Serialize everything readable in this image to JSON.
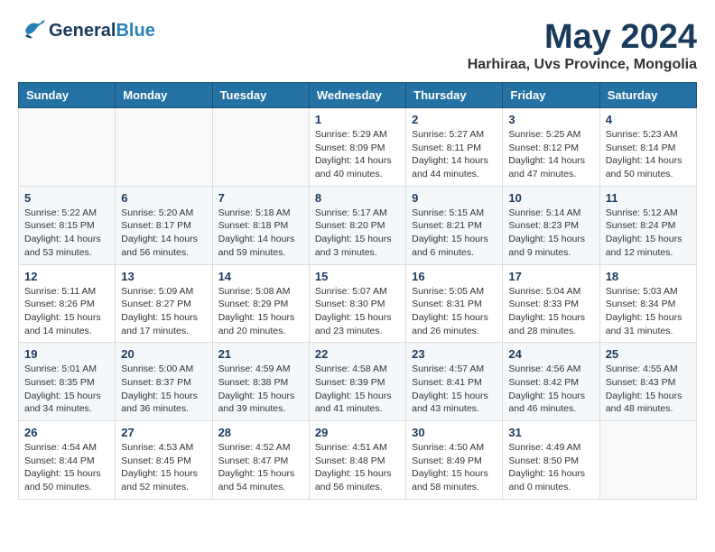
{
  "header": {
    "logo_general": "General",
    "logo_blue": "Blue",
    "month_title": "May 2024",
    "location": "Harhiraa, Uvs Province, Mongolia"
  },
  "weekdays": [
    "Sunday",
    "Monday",
    "Tuesday",
    "Wednesday",
    "Thursday",
    "Friday",
    "Saturday"
  ],
  "weeks": [
    [
      {
        "day": "",
        "info": ""
      },
      {
        "day": "",
        "info": ""
      },
      {
        "day": "",
        "info": ""
      },
      {
        "day": "1",
        "info": "Sunrise: 5:29 AM\nSunset: 8:09 PM\nDaylight: 14 hours\nand 40 minutes."
      },
      {
        "day": "2",
        "info": "Sunrise: 5:27 AM\nSunset: 8:11 PM\nDaylight: 14 hours\nand 44 minutes."
      },
      {
        "day": "3",
        "info": "Sunrise: 5:25 AM\nSunset: 8:12 PM\nDaylight: 14 hours\nand 47 minutes."
      },
      {
        "day": "4",
        "info": "Sunrise: 5:23 AM\nSunset: 8:14 PM\nDaylight: 14 hours\nand 50 minutes."
      }
    ],
    [
      {
        "day": "5",
        "info": "Sunrise: 5:22 AM\nSunset: 8:15 PM\nDaylight: 14 hours\nand 53 minutes."
      },
      {
        "day": "6",
        "info": "Sunrise: 5:20 AM\nSunset: 8:17 PM\nDaylight: 14 hours\nand 56 minutes."
      },
      {
        "day": "7",
        "info": "Sunrise: 5:18 AM\nSunset: 8:18 PM\nDaylight: 14 hours\nand 59 minutes."
      },
      {
        "day": "8",
        "info": "Sunrise: 5:17 AM\nSunset: 8:20 PM\nDaylight: 15 hours\nand 3 minutes."
      },
      {
        "day": "9",
        "info": "Sunrise: 5:15 AM\nSunset: 8:21 PM\nDaylight: 15 hours\nand 6 minutes."
      },
      {
        "day": "10",
        "info": "Sunrise: 5:14 AM\nSunset: 8:23 PM\nDaylight: 15 hours\nand 9 minutes."
      },
      {
        "day": "11",
        "info": "Sunrise: 5:12 AM\nSunset: 8:24 PM\nDaylight: 15 hours\nand 12 minutes."
      }
    ],
    [
      {
        "day": "12",
        "info": "Sunrise: 5:11 AM\nSunset: 8:26 PM\nDaylight: 15 hours\nand 14 minutes."
      },
      {
        "day": "13",
        "info": "Sunrise: 5:09 AM\nSunset: 8:27 PM\nDaylight: 15 hours\nand 17 minutes."
      },
      {
        "day": "14",
        "info": "Sunrise: 5:08 AM\nSunset: 8:29 PM\nDaylight: 15 hours\nand 20 minutes."
      },
      {
        "day": "15",
        "info": "Sunrise: 5:07 AM\nSunset: 8:30 PM\nDaylight: 15 hours\nand 23 minutes."
      },
      {
        "day": "16",
        "info": "Sunrise: 5:05 AM\nSunset: 8:31 PM\nDaylight: 15 hours\nand 26 minutes."
      },
      {
        "day": "17",
        "info": "Sunrise: 5:04 AM\nSunset: 8:33 PM\nDaylight: 15 hours\nand 28 minutes."
      },
      {
        "day": "18",
        "info": "Sunrise: 5:03 AM\nSunset: 8:34 PM\nDaylight: 15 hours\nand 31 minutes."
      }
    ],
    [
      {
        "day": "19",
        "info": "Sunrise: 5:01 AM\nSunset: 8:35 PM\nDaylight: 15 hours\nand 34 minutes."
      },
      {
        "day": "20",
        "info": "Sunrise: 5:00 AM\nSunset: 8:37 PM\nDaylight: 15 hours\nand 36 minutes."
      },
      {
        "day": "21",
        "info": "Sunrise: 4:59 AM\nSunset: 8:38 PM\nDaylight: 15 hours\nand 39 minutes."
      },
      {
        "day": "22",
        "info": "Sunrise: 4:58 AM\nSunset: 8:39 PM\nDaylight: 15 hours\nand 41 minutes."
      },
      {
        "day": "23",
        "info": "Sunrise: 4:57 AM\nSunset: 8:41 PM\nDaylight: 15 hours\nand 43 minutes."
      },
      {
        "day": "24",
        "info": "Sunrise: 4:56 AM\nSunset: 8:42 PM\nDaylight: 15 hours\nand 46 minutes."
      },
      {
        "day": "25",
        "info": "Sunrise: 4:55 AM\nSunset: 8:43 PM\nDaylight: 15 hours\nand 48 minutes."
      }
    ],
    [
      {
        "day": "26",
        "info": "Sunrise: 4:54 AM\nSunset: 8:44 PM\nDaylight: 15 hours\nand 50 minutes."
      },
      {
        "day": "27",
        "info": "Sunrise: 4:53 AM\nSunset: 8:45 PM\nDaylight: 15 hours\nand 52 minutes."
      },
      {
        "day": "28",
        "info": "Sunrise: 4:52 AM\nSunset: 8:47 PM\nDaylight: 15 hours\nand 54 minutes."
      },
      {
        "day": "29",
        "info": "Sunrise: 4:51 AM\nSunset: 8:48 PM\nDaylight: 15 hours\nand 56 minutes."
      },
      {
        "day": "30",
        "info": "Sunrise: 4:50 AM\nSunset: 8:49 PM\nDaylight: 15 hours\nand 58 minutes."
      },
      {
        "day": "31",
        "info": "Sunrise: 4:49 AM\nSunset: 8:50 PM\nDaylight: 16 hours\nand 0 minutes."
      },
      {
        "day": "",
        "info": ""
      }
    ]
  ]
}
